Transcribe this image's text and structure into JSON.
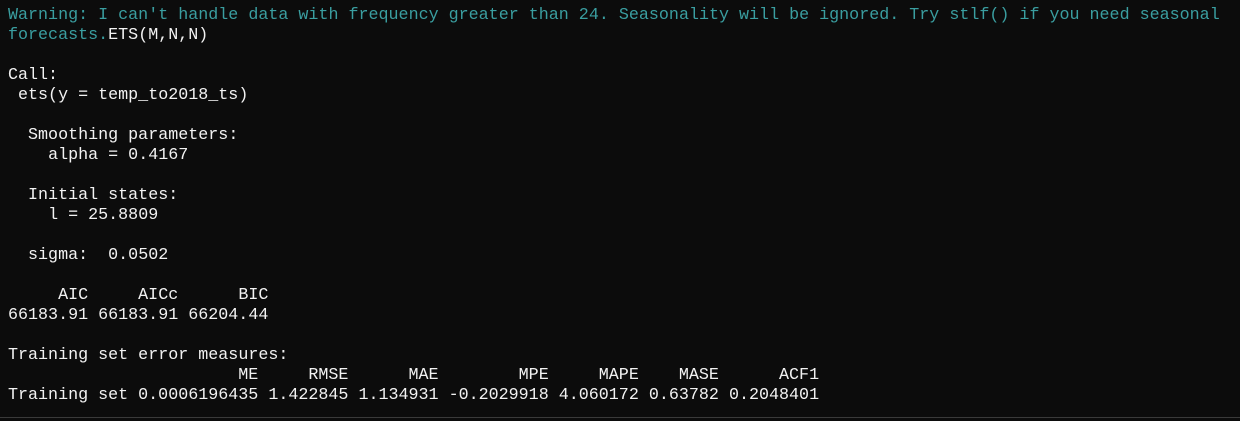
{
  "warning_line1": "Warning: I can't handle data with frequency greater than 24. Seasonality will be ignored. Try stlf() if you need seasonal",
  "warning_line2": "forecasts.",
  "model": "ETS(M,N,N)",
  "call_label": "Call:",
  "call": "ets(y = temp_to2018_ts)",
  "smoothing_label": "Smoothing parameters:",
  "alpha": "alpha = 0.4167",
  "initial_label": "Initial states:",
  "initial_l": "l = 25.8809",
  "sigma_label": "sigma:",
  "sigma_value": "0.0502",
  "info_criteria": {
    "headers": [
      "AIC",
      "AICc",
      "BIC"
    ],
    "values": [
      "66183.91",
      "66183.91",
      "66204.44"
    ]
  },
  "error_measures": {
    "title": "Training set error measures:",
    "headers": [
      "ME",
      "RMSE",
      "MAE",
      "MPE",
      "MAPE",
      "MASE",
      "ACF1"
    ],
    "row_label": "Training set",
    "values": [
      "0.0006196435",
      "1.422845",
      "1.134931",
      "-0.2029918",
      "4.060172",
      "0.63782",
      "0.2048401"
    ]
  }
}
